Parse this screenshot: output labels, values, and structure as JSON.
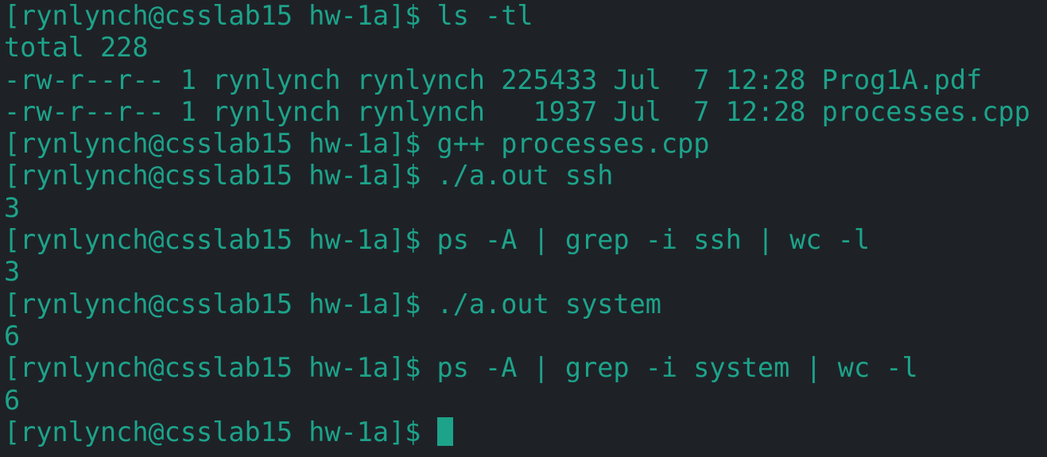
{
  "terminal": {
    "colors": {
      "background": "#1e2227",
      "foreground": "#1da38a"
    },
    "lines": [
      "[rynlynch@csslab15 hw-1a]$ ls -tl",
      "total 228",
      "-rw-r--r-- 1 rynlynch rynlynch 225433 Jul  7 12:28 Prog1A.pdf",
      "-rw-r--r-- 1 rynlynch rynlynch   1937 Jul  7 12:28 processes.cpp",
      "[rynlynch@csslab15 hw-1a]$ g++ processes.cpp",
      "[rynlynch@csslab15 hw-1a]$ ./a.out ssh",
      "3",
      "[rynlynch@csslab15 hw-1a]$ ps -A | grep -i ssh | wc -l",
      "3",
      "[rynlynch@csslab15 hw-1a]$ ./a.out system",
      "6",
      "[rynlynch@csslab15 hw-1a]$ ps -A | grep -i system | wc -l",
      "6"
    ],
    "prompt": "[rynlynch@csslab15 hw-1a]$ "
  }
}
